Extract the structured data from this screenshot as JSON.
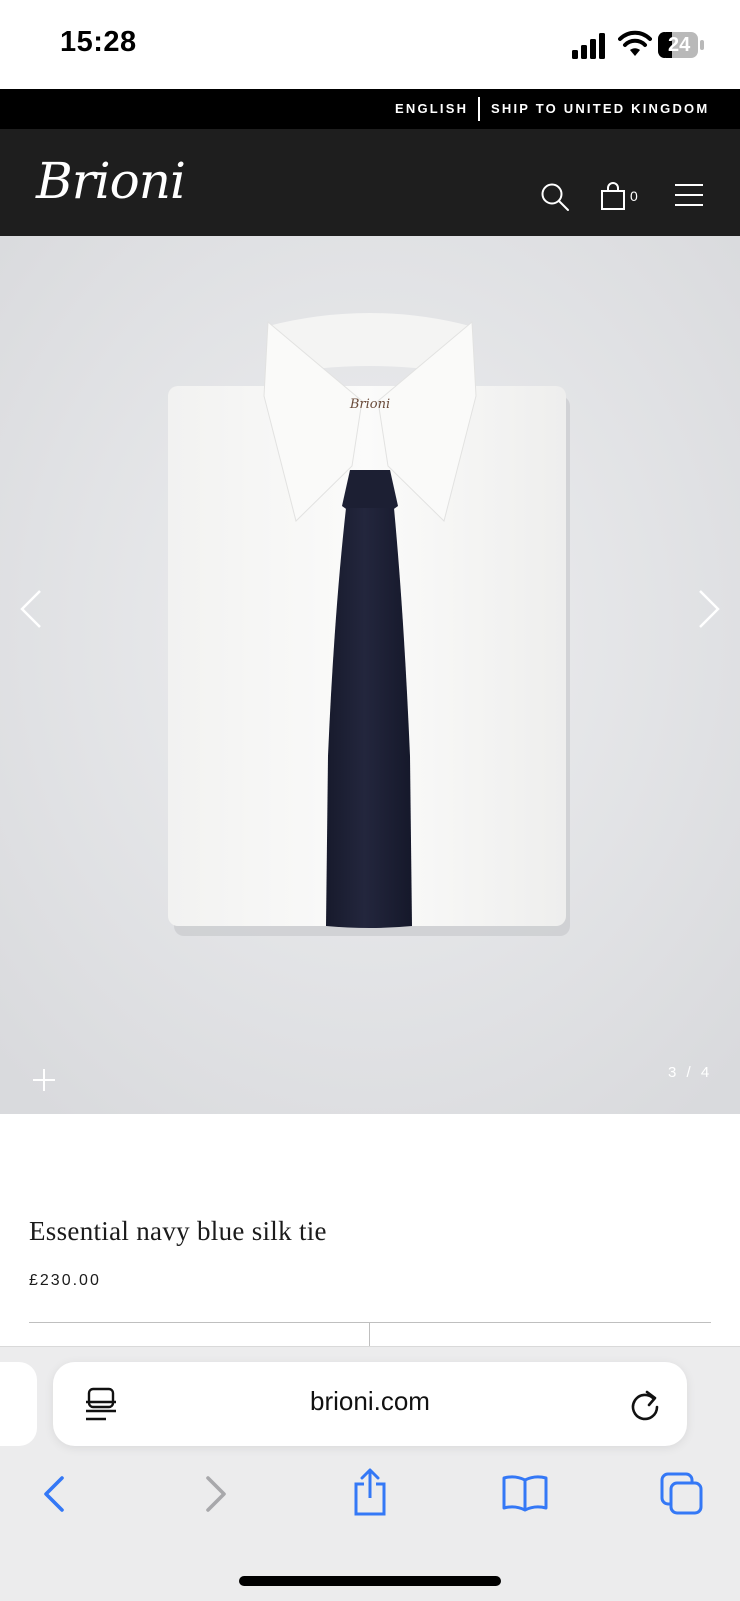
{
  "status_bar": {
    "time": "15:28",
    "battery_level": "24",
    "icons": [
      "signal-icon",
      "wifi-icon",
      "battery-icon"
    ]
  },
  "locale_bar": {
    "language": "ENGLISH",
    "shipping": "SHIP TO UNITED KINGDOM"
  },
  "header": {
    "logo": "Brioni",
    "cart_count": "0",
    "icons": [
      "search-icon",
      "shopping-bag-icon",
      "hamburger-menu-icon"
    ]
  },
  "gallery": {
    "counter": "3 / 4",
    "current_index": 3,
    "total_images": 4,
    "label_on_shirt": "Brioni",
    "icons": [
      "chevron-left-icon",
      "chevron-right-icon",
      "plus-icon"
    ]
  },
  "product": {
    "title": "Essential navy blue silk tie",
    "price": "£230.00"
  },
  "browser": {
    "url": "brioni.com",
    "icons": [
      "reader-icon",
      "reload-icon",
      "back-icon",
      "forward-icon",
      "share-icon",
      "bookmarks-icon",
      "tabs-icon"
    ]
  },
  "colors": {
    "header_bg": "#1e1e1e",
    "locale_bar_bg": "#000000",
    "image_bg": "#e2e3e6",
    "tie_navy": "#1c1f33",
    "ios_blue": "#3478f6"
  }
}
